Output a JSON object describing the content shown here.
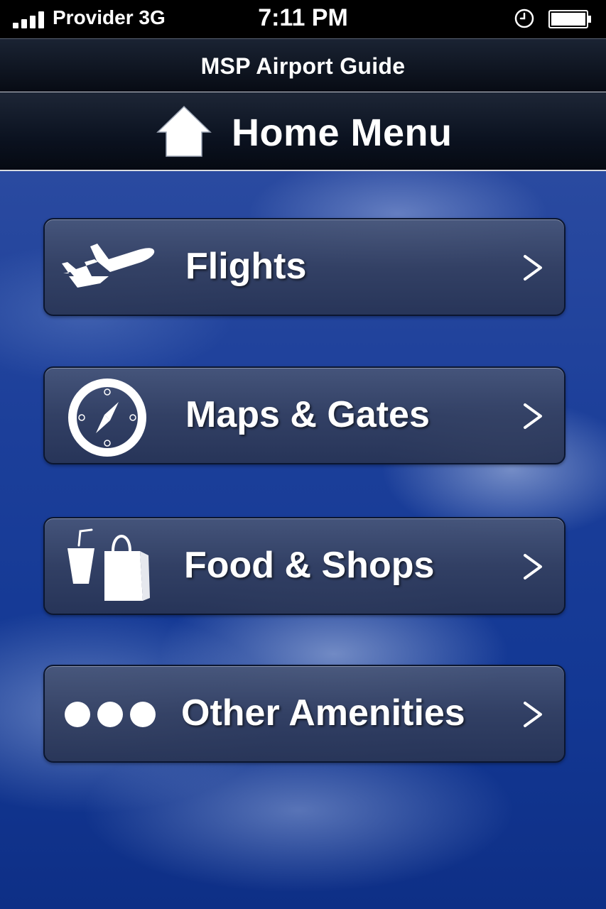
{
  "status_bar": {
    "carrier": "Provider 3G",
    "time": "7:11 PM",
    "signal_icon": "signal-bars-icon",
    "alarm_icon": "clock-icon",
    "battery_icon": "battery-icon"
  },
  "header": {
    "app_title": "MSP Airport Guide",
    "page_title": "Home Menu",
    "page_icon": "home-icon"
  },
  "menu": {
    "items": [
      {
        "label": "Flights",
        "icon": "airplane-icon"
      },
      {
        "label": "Maps & Gates",
        "icon": "compass-icon"
      },
      {
        "label": "Food & Shops",
        "icon": "drink-and-shopping-bag-icon"
      },
      {
        "label": "Other Amenities",
        "icon": "three-dots-icon"
      }
    ]
  },
  "colors": {
    "status_bar": "#000000",
    "header": "#0b1220",
    "sky": "#1c3f9a",
    "button": "#3a4a74",
    "text": "#ffffff"
  }
}
